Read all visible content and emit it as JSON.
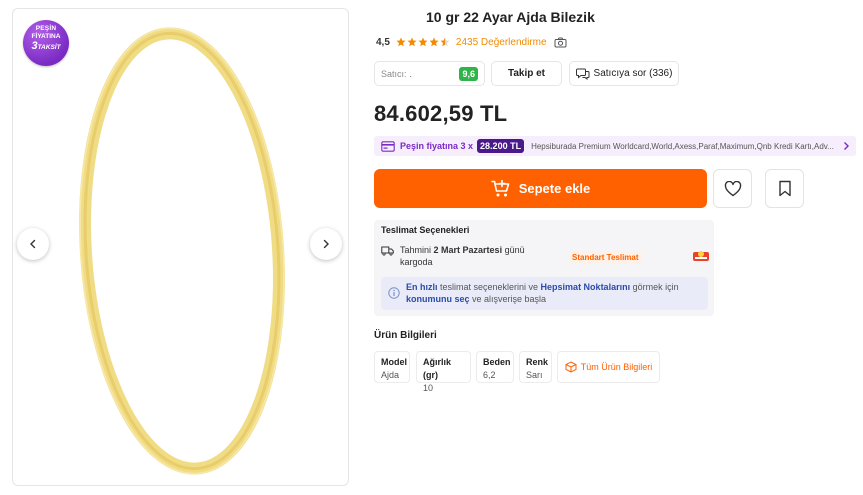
{
  "gallery": {
    "badge": {
      "line1": "PEŞİN",
      "line2": "FİYATINA",
      "line3_num": "3",
      "line3_txt": "TAKSİT"
    }
  },
  "product": {
    "title": "10 gr 22 Ayar Ajda Bilezik",
    "rating": "4,5",
    "reviews": "2435 Değerlendirme",
    "stars": 4.5,
    "price": "84.602,59 TL"
  },
  "seller": {
    "label": "Satıcı:",
    "name": ".",
    "score": "9,6",
    "follow": "Takip et",
    "ask": "Satıcıya sor (336)"
  },
  "installment": {
    "label": "Peşin fiyatına 3 x",
    "amount": "28.200 TL",
    "banks": "Hepsiburada Premium Worldcard,World,Axess,Paraf,Maximum,Qnb Kredi Kartı,Adv..."
  },
  "cart": {
    "label": "Sepete ekle"
  },
  "delivery": {
    "title": "Teslimat Seçenekleri",
    "pre": "Tahmini",
    "date": "2 Mart Pazartesi",
    "post": "günü kargoda",
    "tag": "Standart Teslimat",
    "info_hl1": "En hızlı",
    "info_t1": " teslimat seçeneklerini ve ",
    "info_hl2": "Hepsimat Noktalarını",
    "info_t2": " görmek için ",
    "info_hl3": "konumunu seç",
    "info_t3": " ve alışverişe başla"
  },
  "product_info": {
    "title": "Ürün Bilgileri",
    "attributes": [
      {
        "key": "Model",
        "value": "Ajda"
      },
      {
        "key": "Ağırlık (gr)",
        "value": "10"
      },
      {
        "key": "Beden",
        "value": "6,2"
      },
      {
        "key": "Renk",
        "value": "Sarı"
      }
    ],
    "all_label": "Tüm Ürün Bilgileri"
  },
  "colors": {
    "accent": "#ff6000",
    "purple": "#7a2bc4",
    "score_green": "#2fb34a",
    "gold": "#f3dc7e"
  }
}
